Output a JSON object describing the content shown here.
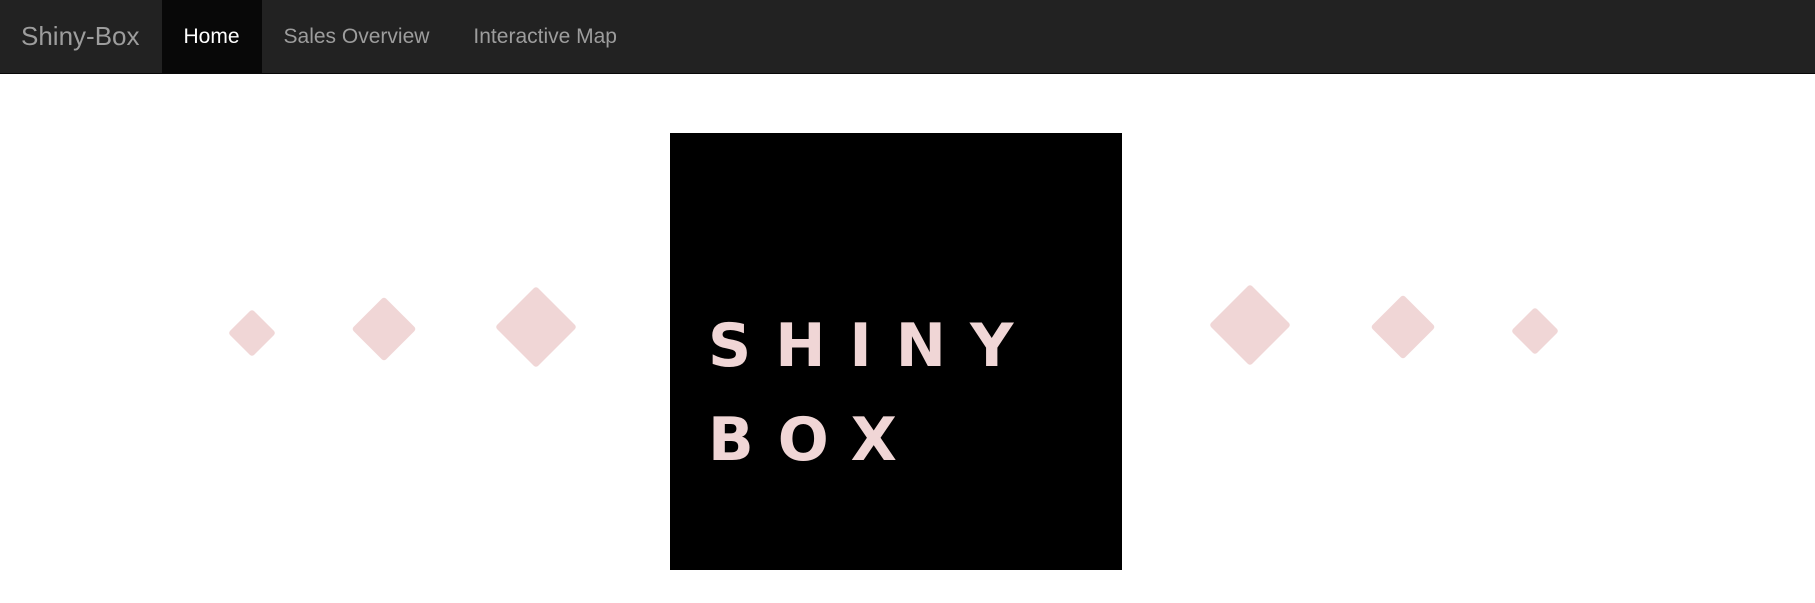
{
  "navbar": {
    "brand": "Shiny-Box",
    "items": [
      {
        "label": "Home",
        "active": true
      },
      {
        "label": "Sales Overview",
        "active": false
      },
      {
        "label": "Interactive Map",
        "active": false
      }
    ]
  },
  "logo": {
    "line1": "SHINY",
    "line2": "BOX"
  },
  "colors": {
    "navbar_bg": "#222222",
    "nav_text": "#9d9d9d",
    "nav_active_bg": "#080808",
    "nav_active_text": "#ffffff",
    "diamond": "#f0d6d6",
    "logo_bg": "#000000",
    "logo_text": "#f0d6d6"
  }
}
